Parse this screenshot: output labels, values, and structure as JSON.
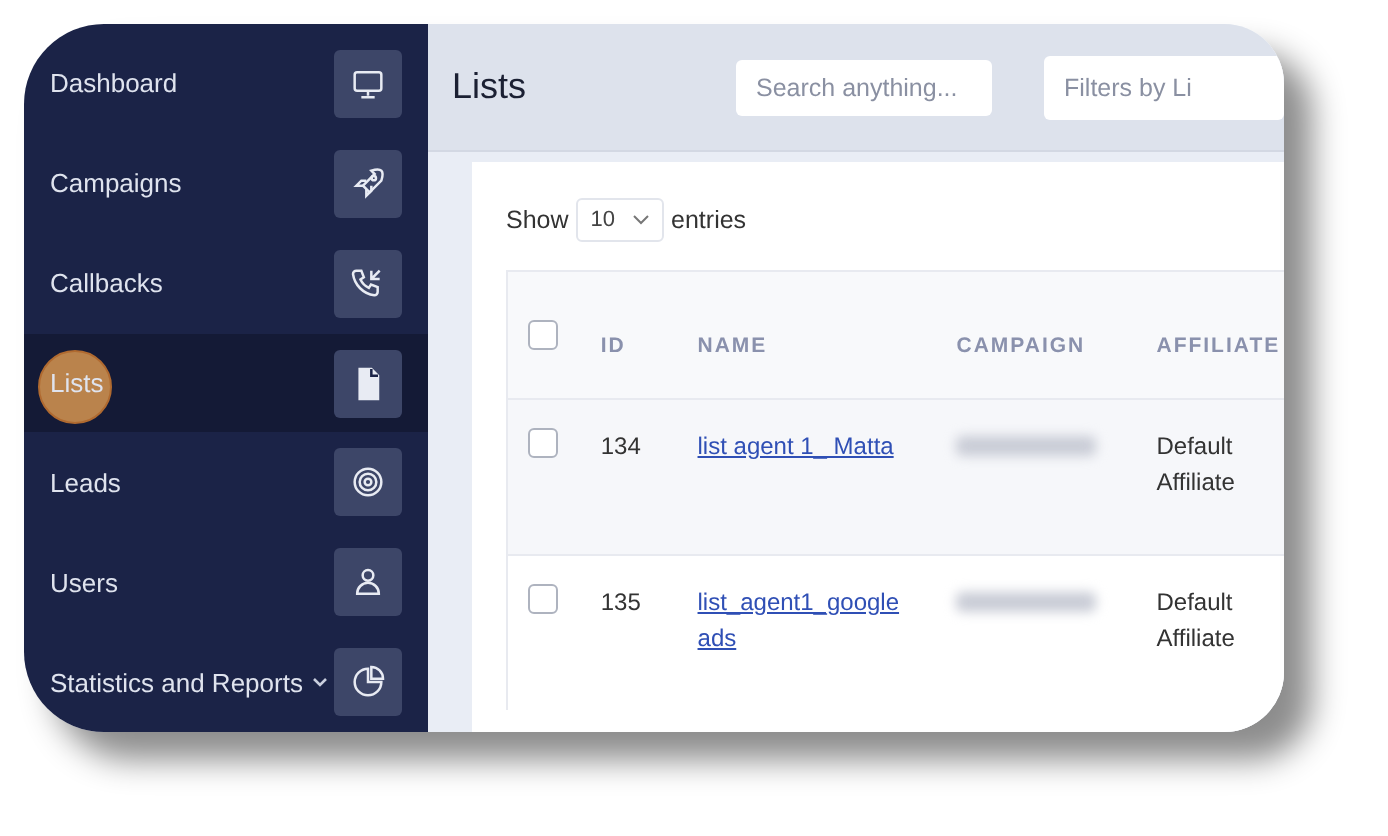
{
  "sidebar": {
    "items": [
      {
        "label": "Dashboard",
        "selected": false
      },
      {
        "label": "Campaigns",
        "selected": false
      },
      {
        "label": "Callbacks",
        "selected": false
      },
      {
        "label": "Lists",
        "selected": true
      },
      {
        "label": "Leads",
        "selected": false
      },
      {
        "label": "Users",
        "selected": false
      },
      {
        "label": "Statistics and Reports",
        "selected": false,
        "expandable": true
      }
    ]
  },
  "header": {
    "title": "Lists",
    "search": {
      "placeholder": "Search anything..."
    },
    "filter": {
      "placeholder": "Filters by Li"
    }
  },
  "entries": {
    "before": "Show",
    "value": "10",
    "after": "entries"
  },
  "table": {
    "select_all": {
      "checked": false
    },
    "columns": [
      "ID",
      "NAME",
      "CAMPAIGN",
      "AFFILIATE"
    ],
    "rows": [
      {
        "checked": false,
        "id": "134",
        "name": "list agent 1_ Matta",
        "affiliate": "Default Affiliate"
      },
      {
        "checked": false,
        "id": "135",
        "name": "list_agent1_google ads",
        "affiliate": "Default Affiliate"
      }
    ]
  }
}
